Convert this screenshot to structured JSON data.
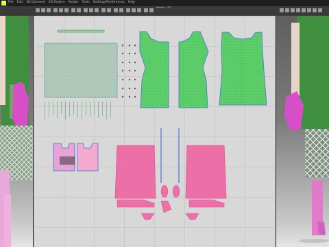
{
  "app": {
    "window_title": "Pattern - 2D"
  },
  "menu": {
    "items": [
      "File",
      "Edit",
      "3D Garment",
      "2D Pattern",
      "Avatar",
      "Tools",
      "Settings/Preferences",
      "Help"
    ]
  },
  "colors": {
    "fabric_green": "#5ccf6a",
    "fabric_pink": "#ec6fa8",
    "pink_light": "#f4a9cf",
    "seam_blue": "#4a6fd8",
    "bg_2d": "#d8d8d8"
  },
  "icons": [
    "select-icon",
    "move-icon",
    "transform-icon",
    "polygon-icon",
    "rectangle-icon",
    "circle-icon",
    "internal-line-icon",
    "dart-icon",
    "sew-icon",
    "segment-sew-icon",
    "free-sew-icon",
    "fold-icon",
    "tack-icon",
    "pin-icon",
    "texture-icon",
    "zipper-icon",
    "button-icon",
    "topstitch-icon",
    "graphic-icon",
    "trim-icon"
  ]
}
